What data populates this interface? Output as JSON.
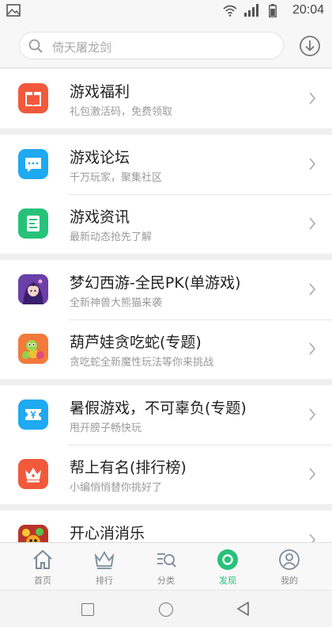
{
  "status_bar": {
    "time": "20:04",
    "icons": [
      "image-icon",
      "wifi-icon",
      "signal-icon",
      "battery-icon"
    ]
  },
  "search": {
    "placeholder": "倚天屠龙剑",
    "icon": "search-icon",
    "download_icon": "download-icon"
  },
  "groups": [
    {
      "items": [
        {
          "title": "游戏福利",
          "subtitle": "礼包激活码，免费领取",
          "icon": "gift-icon",
          "color": "#f2593c"
        }
      ]
    },
    {
      "items": [
        {
          "title": "游戏论坛",
          "subtitle": "千万玩家，聚集社区",
          "icon": "chat-icon",
          "color": "#1fa9f0"
        },
        {
          "title": "游戏资讯",
          "subtitle": "最新动态抢先了解",
          "icon": "news-icon",
          "color": "#27c27a"
        }
      ]
    },
    {
      "items": [
        {
          "title": "梦幻西游-全民PK(单游戏)",
          "subtitle": "全新神兽大熊猫来袭",
          "icon": "game-avatar-icon",
          "color": "#7b4ab8"
        },
        {
          "title": "葫芦娃贪吃蛇(专题)",
          "subtitle": "贪吃蛇全新魔性玩法等你来挑战",
          "icon": "snake-game-icon",
          "color": "#f5733c"
        }
      ]
    },
    {
      "items": [
        {
          "title": "暑假游戏，不可辜负(专题)",
          "subtitle": "甩开膀子畅快玩",
          "icon": "ticket-icon",
          "color": "#1fa9f0"
        },
        {
          "title": "帮上有名(排行榜)",
          "subtitle": "小编悄悄替你挑好了",
          "icon": "crown-icon",
          "color": "#f2593c"
        }
      ]
    },
    {
      "items": [
        {
          "title": "开心消消乐",
          "subtitle": "",
          "icon": "match-game-icon",
          "color": "#c83a2a"
        }
      ]
    }
  ],
  "bottom_nav": [
    {
      "label": "首页",
      "icon": "home-icon",
      "active": false
    },
    {
      "label": "排行",
      "icon": "crown-icon",
      "active": false
    },
    {
      "label": "分类",
      "icon": "category-search-icon",
      "active": false
    },
    {
      "label": "发现",
      "icon": "discover-icon",
      "active": true
    },
    {
      "label": "我的",
      "icon": "profile-icon",
      "active": false
    }
  ],
  "colors": {
    "accent_green": "#27c27a",
    "orange": "#f2593c",
    "blue": "#1fa9f0"
  }
}
